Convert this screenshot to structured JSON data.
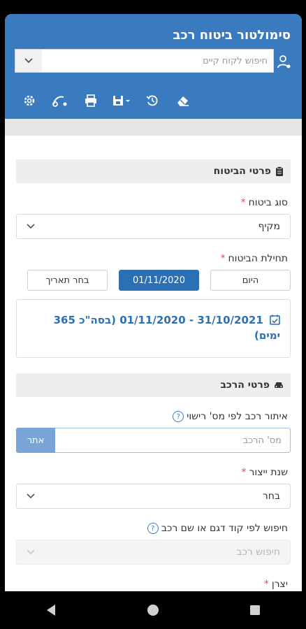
{
  "header": {
    "title": "סימולטור ביטוח רכב",
    "search_placeholder": "חיפוש לקוח קיים"
  },
  "toolbar": {
    "icons": [
      "gear-icon",
      "scooter-icon",
      "print-icon",
      "save-dropdown-icon",
      "history-icon",
      "eraser-icon"
    ]
  },
  "insurance": {
    "section_title": "פרטי הביטוח",
    "type_label": "סוג ביטוח",
    "type_value": "מקיף",
    "start_label": "תחילת הביטוח",
    "today_label": "היום",
    "date_value": "01/11/2020",
    "choose_date_label": "בחר תאריך",
    "period_text": "31/10/2021 - 01/11/2020 (בסה\"כ 365 ימים)"
  },
  "vehicle": {
    "section_title": "פרטי הרכב",
    "plate_label": "איתור רכב לפי מס' רישוי",
    "plate_placeholder": "מס' הרכב",
    "plate_button": "אתר",
    "year_label": "שנת ייצור",
    "year_value": "בחר",
    "model_search_label": "חיפוש לפי קוד דגם או שם רכב",
    "model_search_placeholder": "חיפוש רכב",
    "manufacturer_label": "יצרן"
  },
  "colors": {
    "header_bg": "#3a7bbf",
    "active_button": "#2d6fb4",
    "required": "#d9534f"
  }
}
